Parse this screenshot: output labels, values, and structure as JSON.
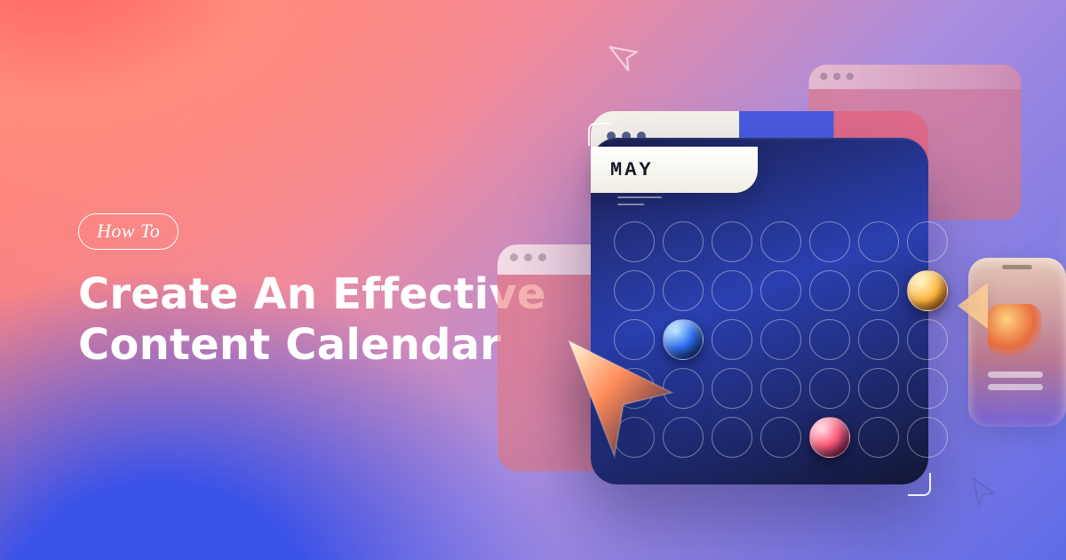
{
  "badge": "How To",
  "title_line1": "Create An Effective",
  "title_line2": "Content Calendar",
  "month": "MAY"
}
